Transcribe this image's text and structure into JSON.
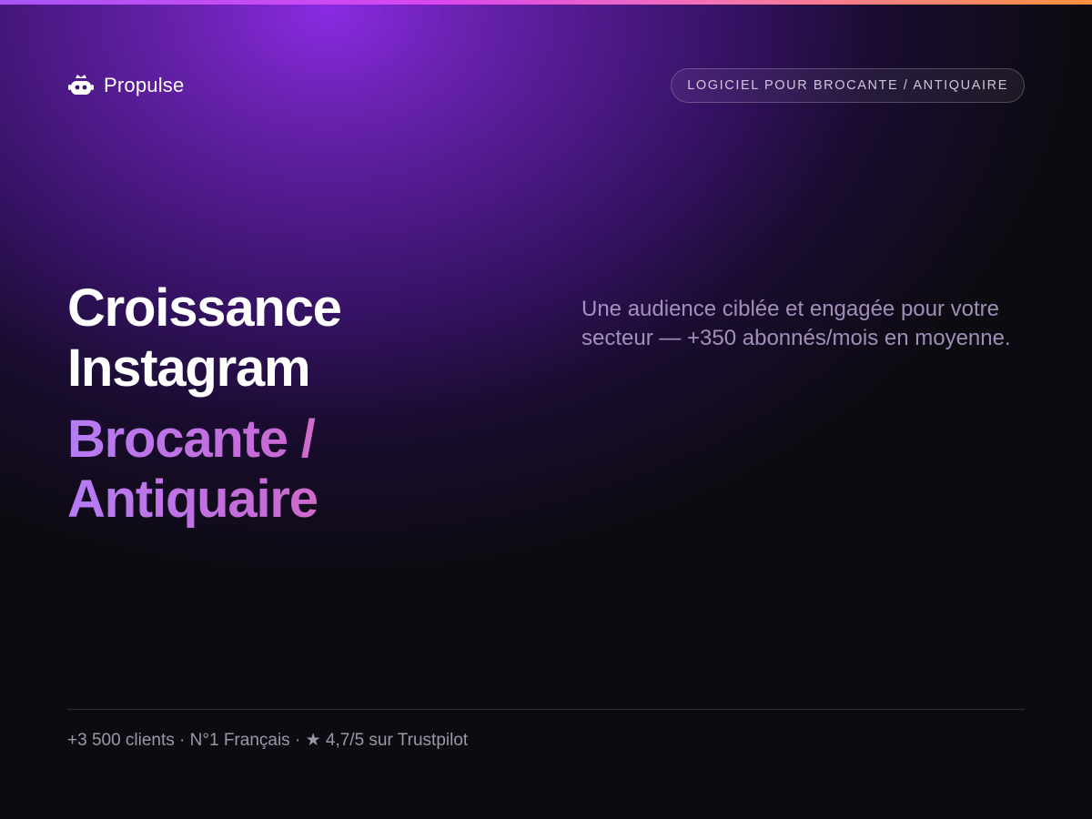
{
  "brand": {
    "name": "Propulse",
    "icon": "robot-crown-icon"
  },
  "badge": {
    "label": "LOGICIEL POUR BROCANTE / ANTIQUAIRE"
  },
  "hero": {
    "title_line1": "Croissance",
    "title_line2": "Instagram",
    "accent_line1": "Brocante /",
    "accent_line2": "Antiquaire",
    "subtitle": "Une audience ciblée et engagée pour votre secteur — +350 abonnés/mois en moyenne."
  },
  "footer": {
    "stats": "+3 500 clients · N°1 Français · ★ 4,7/5 sur Trustpilot"
  },
  "colors": {
    "background": "#0d0b12",
    "glow": "#8a2be2",
    "accent_start": "#b57cf5",
    "accent_end": "#f06c92",
    "top_bar_start": "#a855f7",
    "top_bar_end": "#fb923c"
  }
}
